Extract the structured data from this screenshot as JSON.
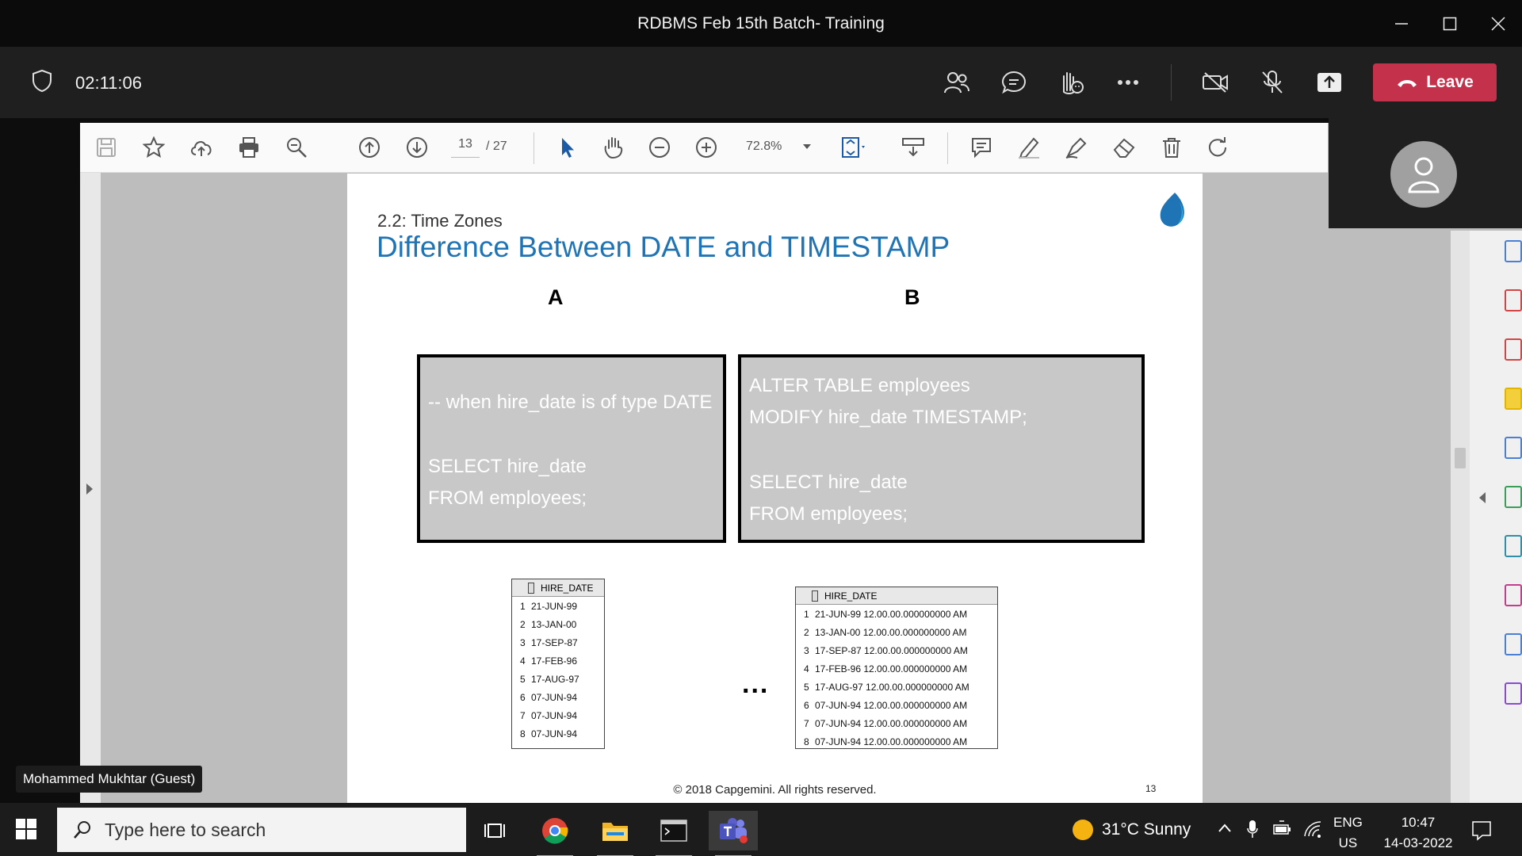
{
  "window": {
    "title": "RDBMS Feb 15th Batch- Training"
  },
  "meeting": {
    "timer": "02:11:06",
    "leave_label": "Leave"
  },
  "pdf": {
    "page_current": "13",
    "page_total": "/ 27",
    "zoom": "72.8%"
  },
  "slide": {
    "subtitle": "2.2: Time Zones",
    "title": "Difference Between DATE and TIMESTAMP",
    "label_a": "A",
    "label_b": "B",
    "code_a": [
      "-- when hire_date is of type DATE",
      "SELECT hire_date",
      "FROM employees;"
    ],
    "code_b": [
      "ALTER TABLE employees",
      "MODIFY hire_date TIMESTAMP;",
      "SELECT hire_date",
      "FROM employees;"
    ],
    "grid_a": {
      "header": "HIRE_DATE",
      "rows": [
        [
          "1",
          "21-JUN-99"
        ],
        [
          "2",
          "13-JAN-00"
        ],
        [
          "3",
          "17-SEP-87"
        ],
        [
          "4",
          "17-FEB-96"
        ],
        [
          "5",
          "17-AUG-97"
        ],
        [
          "6",
          "07-JUN-94"
        ],
        [
          "7",
          "07-JUN-94"
        ],
        [
          "8",
          "07-JUN-94"
        ]
      ]
    },
    "grid_b": {
      "header": "HIRE_DATE",
      "rows": [
        [
          "1",
          "21-JUN-99 12.00.00.000000000 AM"
        ],
        [
          "2",
          "13-JAN-00 12.00.00.000000000 AM"
        ],
        [
          "3",
          "17-SEP-87 12.00.00.000000000 AM"
        ],
        [
          "4",
          "17-FEB-96 12.00.00.000000000 AM"
        ],
        [
          "5",
          "17-AUG-97 12.00.00.000000000 AM"
        ],
        [
          "6",
          "07-JUN-94 12.00.00.000000000 AM"
        ],
        [
          "7",
          "07-JUN-94 12.00.00.000000000 AM"
        ],
        [
          "8",
          "07-JUN-94 12.00.00.000000000 AM"
        ]
      ]
    },
    "ellipsis": "...",
    "footer": "© 2018 Capgemini. All rights reserved.",
    "page_number": "13"
  },
  "participant": {
    "name": "Mohammed Mukhtar (Guest)"
  },
  "taskbar": {
    "search_placeholder": "Type here to search",
    "weather": "31°C  Sunny",
    "lang_1": "ENG",
    "lang_2": "US",
    "time": "10:47",
    "date": "14-03-2022"
  },
  "colors": {
    "leave": "#c4314b",
    "slide_title": "#1f74b6",
    "teams_accent": "#5b5fc7"
  }
}
